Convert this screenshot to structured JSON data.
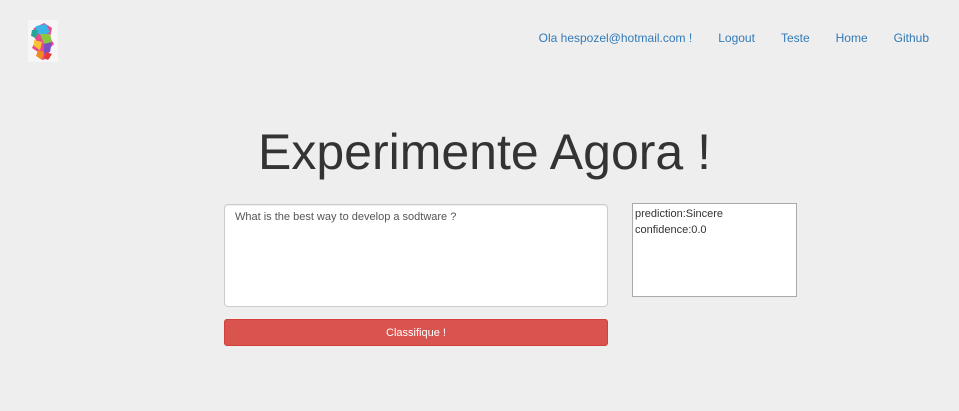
{
  "header": {
    "logo_icon": "colorful-head-logo-icon",
    "nav": [
      {
        "label": "Ola hespozel@hotmail.com !"
      },
      {
        "label": "Logout"
      },
      {
        "label": "Teste"
      },
      {
        "label": "Home"
      },
      {
        "label": "Github"
      }
    ]
  },
  "main": {
    "title": "Experimente Agora !",
    "query_value": "What is the best way to develop a sodtware ?",
    "classify_label": "Classifique !",
    "result": {
      "prediction_line": "prediction:Sincere",
      "confidence_line": "confidence:0.0"
    }
  },
  "colors": {
    "background": "#eeeeee",
    "link": "#337ab7",
    "button_danger": "#d9534f"
  }
}
